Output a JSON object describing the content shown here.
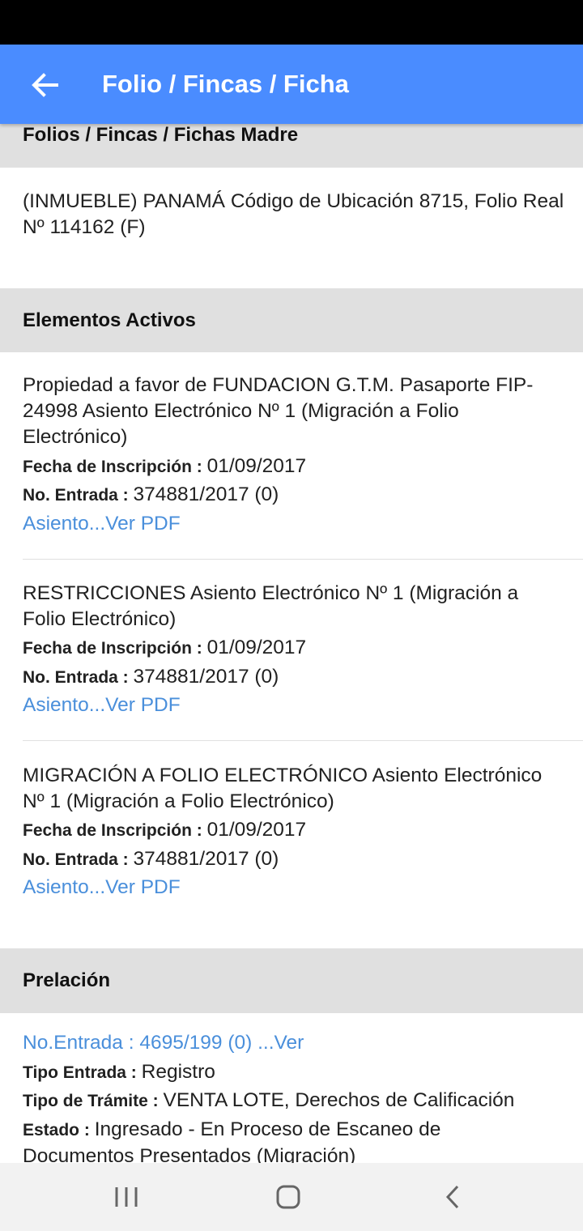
{
  "app_bar": {
    "title": "Folio / Fincas / Ficha",
    "back_icon": "arrow-left-icon"
  },
  "folios_madre": {
    "header": "Folios / Fincas / Fichas Madre",
    "text": "(INMUEBLE) PANAMÁ Código de Ubicación 8715, Folio Real Nº 114162 (F)"
  },
  "elementos_activos": {
    "header": "Elementos Activos",
    "items": [
      {
        "description": "Propiedad a favor de FUNDACION G.T.M. Pasaporte FIP-24998 Asiento Electrónico Nº 1 (Migración a Folio Electrónico)",
        "fecha_label": "Fecha de Inscripción : ",
        "fecha_value": "01/09/2017",
        "entrada_label": "No. Entrada : ",
        "entrada_value": "374881/2017 (0)",
        "link": "Asiento...Ver PDF"
      },
      {
        "description": "RESTRICCIONES Asiento Electrónico Nº 1 (Migración a Folio Electrónico)",
        "fecha_label": "Fecha de Inscripción : ",
        "fecha_value": "01/09/2017",
        "entrada_label": "No. Entrada : ",
        "entrada_value": "374881/2017 (0)",
        "link": "Asiento...Ver PDF"
      },
      {
        "description": "MIGRACIÓN A FOLIO ELECTRÓNICO Asiento Electrónico Nº 1 (Migración a Folio Electrónico)",
        "fecha_label": "Fecha de Inscripción : ",
        "fecha_value": "01/09/2017",
        "entrada_label": "No. Entrada : ",
        "entrada_value": "374881/2017 (0)",
        "link": "Asiento...Ver PDF"
      }
    ]
  },
  "prelacion": {
    "header": "Prelación",
    "link": "No.Entrada : 4695/199 (0) ...Ver",
    "tipo_entrada_label": "Tipo Entrada : ",
    "tipo_entrada_value": "Registro",
    "tipo_tramite_label": "Tipo de Trámite : ",
    "tipo_tramite_value": "VENTA LOTE, Derechos de Calificación",
    "estado_label": "Estado : ",
    "estado_value": "Ingresado - En Proceso de Escaneo de Documentos Presentados (Migración)"
  },
  "nav": {
    "recents_icon": "recent-apps-icon",
    "home_icon": "home-icon",
    "back_icon": "back-chevron-icon"
  },
  "colors": {
    "app_bar": "#4a8cff",
    "link": "#4a8fdb",
    "section_header": "#e0e0e0"
  }
}
